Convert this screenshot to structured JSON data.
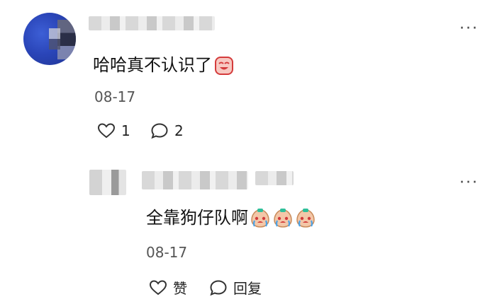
{
  "comment": {
    "text": "哈哈真不认识了",
    "date": "08-17",
    "likes": "1",
    "replies": "2",
    "more_icon": "more-icon"
  },
  "reply": {
    "text": "全靠狗仔队啊",
    "date": "08-17",
    "like_label": "赞",
    "reply_label": "回复",
    "more_icon": "more-icon"
  },
  "colors": {
    "avatar_blue": "#2a45b8",
    "text": "#111111",
    "meta": "#555555"
  }
}
